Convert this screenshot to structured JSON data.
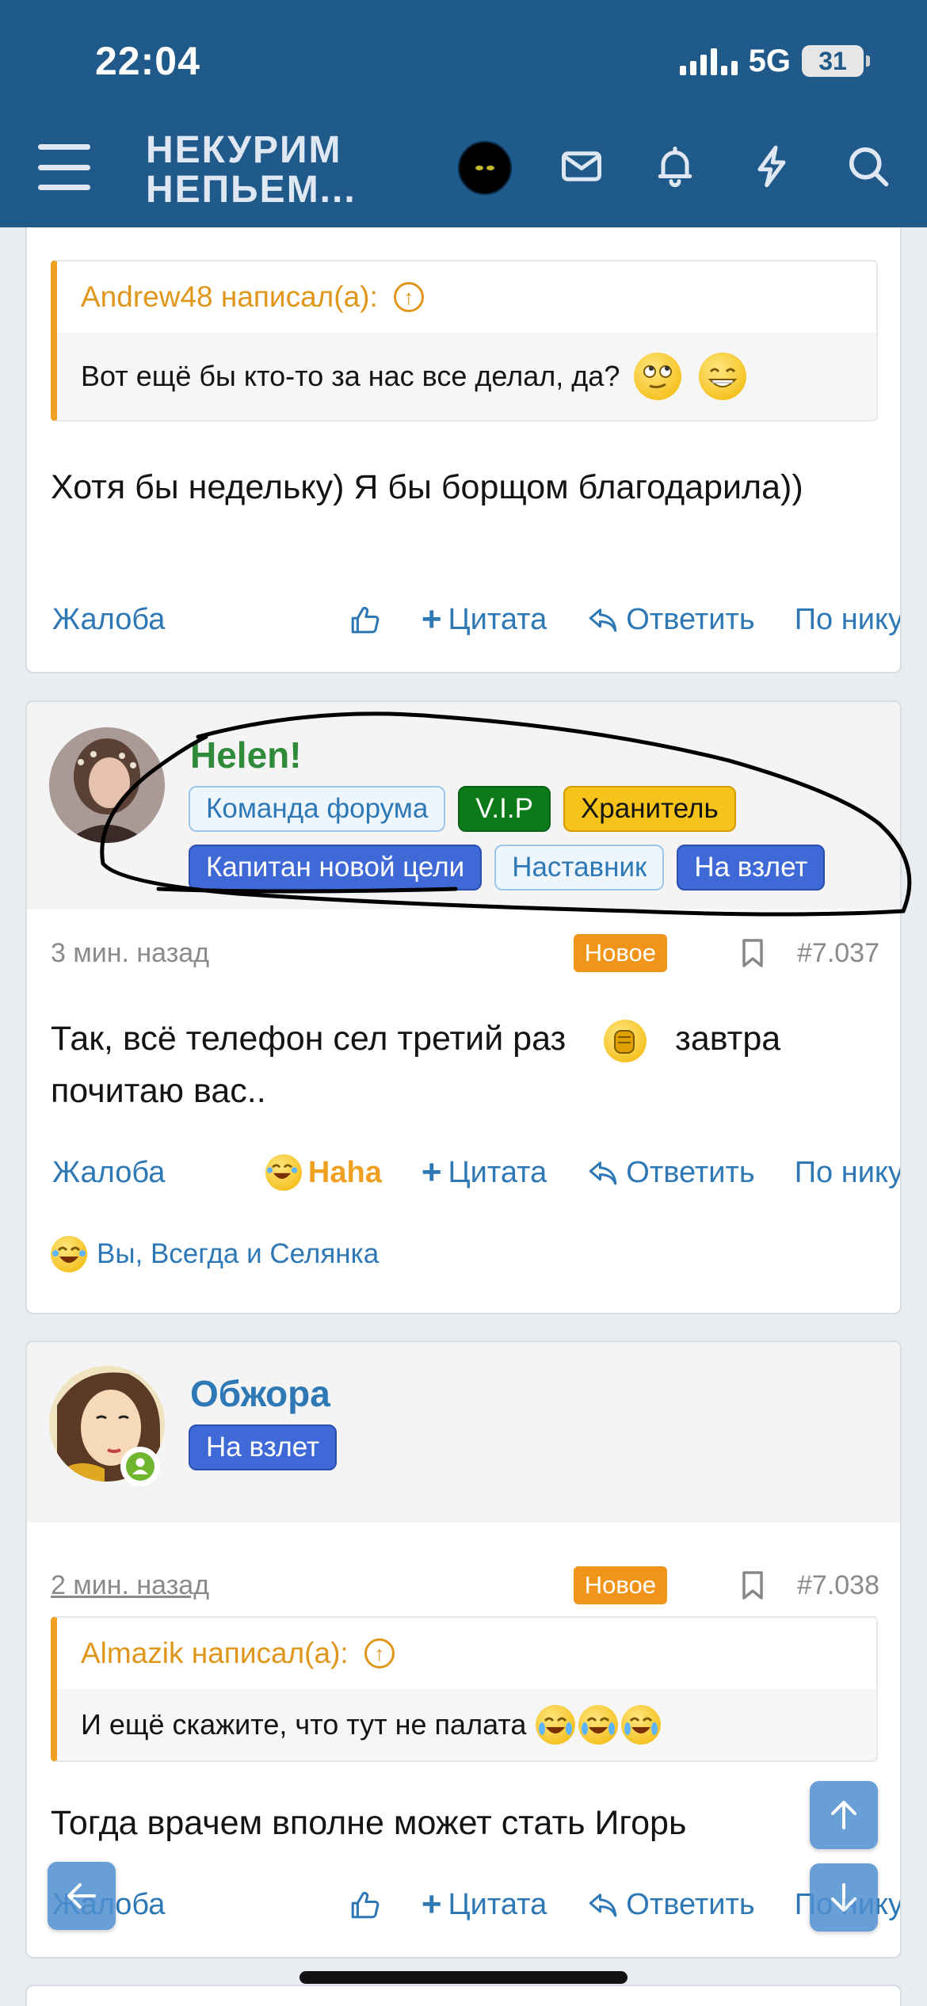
{
  "status_bar": {
    "time": "22:04",
    "network": "5G",
    "battery": "31"
  },
  "header": {
    "logo_line1": "НЕКУРИМ",
    "logo_line2": "НЕПЬЕМ..."
  },
  "posts": [
    {
      "quote": {
        "author": "Andrew48 написал(а):",
        "text": "Вот ещё бы кто-то за нас все делал, да?"
      },
      "text": "Хотя бы недельку) Я бы борщом благодарила))",
      "actions": {
        "report": "Жалоба",
        "quote": "Цитата",
        "reply": "Ответить",
        "by_nick": "По нику"
      }
    },
    {
      "username": "Helen!",
      "username_color": "#2f8a3a",
      "badges": [
        "Команда форума",
        "V.I.P",
        "Хранитель",
        "Капитан новой цели",
        "Наставник",
        "На взлет"
      ],
      "time": "3 мин. назад",
      "new_label": "Новое",
      "post_number": "#7.037",
      "text_before": "Так, всё телефон сел третий раз",
      "text_after": "завтра почитаю вас..",
      "actions": {
        "report": "Жалоба",
        "reaction": "Haha",
        "quote": "Цитата",
        "reply": "Ответить",
        "by_nick": "По нику"
      },
      "reactors": "Вы, Всегда и Селянка"
    },
    {
      "username": "Обжора",
      "username_color": "#2e78b6",
      "badges": [
        "На взлет"
      ],
      "time": "2 мин. назад",
      "new_label": "Новое",
      "post_number": "#7.038",
      "quote": {
        "author": "Almazik написал(а):",
        "text": "И ещё скажите, что тут не палата"
      },
      "text": "Тогда врачем вполне может стать Игорь",
      "actions": {
        "report": "Жалоба",
        "quote": "Цитата",
        "reply": "Ответить",
        "by_nick": "По нику"
      }
    }
  ],
  "icons": {
    "menu": "hamburger-icon",
    "inbox": "envelope-icon",
    "alerts": "bell-icon",
    "whats_new": "lightning-icon",
    "search": "search-icon",
    "like": "thumbs-up-icon",
    "reply": "reply-arrow-icon",
    "bookmark": "bookmark-icon",
    "quote_link": "arrow-up-circle-icon",
    "scroll_up": "arrow-up-icon",
    "scroll_down": "arrow-down-icon",
    "back": "arrow-left-icon"
  },
  "colors": {
    "header_bg": "#1f5a8a",
    "link": "#2e78b6",
    "quote_accent": "#f0a020",
    "new_badge": "#f0941a"
  }
}
